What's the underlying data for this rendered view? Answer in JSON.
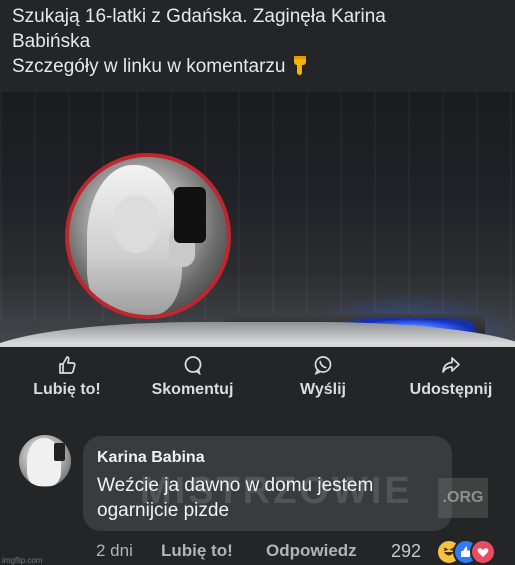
{
  "post": {
    "line1": "Szukają 16-latki z Gdańska. Zaginęła Karina",
    "line2": "Babińska",
    "line3": "Szczegóły w linku w komentarzu",
    "emoji": "pointing-down-hand-icon"
  },
  "actions": {
    "like": "Lubię to!",
    "comment": "Skomentuj",
    "send": "Wyślij",
    "share": "Udostępnij"
  },
  "comment": {
    "author": "Karina Babina",
    "line1": "Weźcie ja dawno w domu jestem",
    "line2": "ogarnijcie pizde",
    "time": "2 dni",
    "like_label": "Lubię to!",
    "reply_label": "Odpowiedz",
    "reaction_count": "292",
    "reactions": [
      "haha-icon",
      "like-icon",
      "love-icon"
    ]
  },
  "watermark": {
    "text": "MISTRZOWIE",
    "org": ".ORG"
  },
  "corner_text": "imgflip.com",
  "colors": {
    "background": "#232526",
    "bubble": "#3a3b3c",
    "portrait_border": "#c0262d",
    "blue_light": "#3d6bff"
  }
}
